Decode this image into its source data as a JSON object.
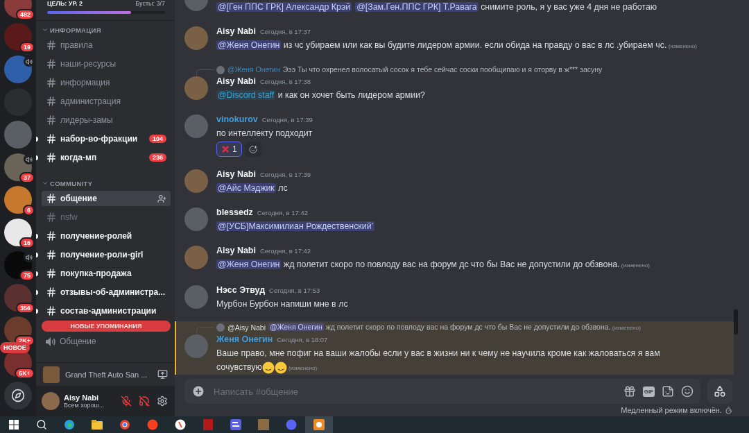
{
  "servers": [
    {
      "badge": "482",
      "speaker": false
    },
    {
      "badge": "19",
      "speaker": false
    },
    {
      "speaker": true
    },
    {
      "speaker": false
    },
    {
      "speaker": false
    },
    {
      "badge": "37",
      "speaker": true
    },
    {
      "badge": "6",
      "speaker": false
    },
    {
      "badge": "16",
      "speaker": false
    },
    {
      "badge": "75",
      "speaker": true
    },
    {
      "badge": "356",
      "speaker": false
    },
    {
      "badge": "2K+",
      "speaker": false
    },
    {
      "badge": "5K+",
      "speaker": false,
      "pill": "НОВОЕ"
    }
  ],
  "boost": {
    "goal": "ЦЕЛЬ: УР. 2",
    "count": "Бусты: 3/7",
    "level": 0.71
  },
  "categories": [
    {
      "name": "ИНФОРМАЦИЯ",
      "expanded": true,
      "channels": [
        {
          "name": "правила",
          "kind": "text",
          "unread": false,
          "selected": false
        },
        {
          "name": "наши-ресурсы",
          "kind": "text",
          "unread": false,
          "selected": false
        },
        {
          "name": "информация",
          "kind": "text",
          "unread": false,
          "selected": false
        },
        {
          "name": "администрация",
          "kind": "text",
          "unread": false,
          "selected": false
        },
        {
          "name": "лидеры-замы",
          "kind": "text",
          "unread": false,
          "selected": false
        },
        {
          "name": "набор-во-фракции",
          "kind": "text",
          "unread": true,
          "selected": false,
          "badge": "104"
        },
        {
          "name": "когда-мп",
          "kind": "text",
          "unread": true,
          "selected": false,
          "badge": "236"
        }
      ]
    },
    {
      "name": "COMMUNITY",
      "expanded": true,
      "channels": [
        {
          "name": "общение",
          "kind": "text",
          "unread": false,
          "selected": true
        },
        {
          "name": "nsfw",
          "kind": "nsfw",
          "unread": false,
          "selected": false
        },
        {
          "name": "получение-ролей",
          "kind": "text",
          "unread": true,
          "selected": false
        },
        {
          "name": "получение-роли-girl",
          "kind": "text",
          "unread": true,
          "selected": false
        },
        {
          "name": "покупка-продажа",
          "kind": "text",
          "unread": true,
          "selected": false
        },
        {
          "name": "отзывы-об-администра...",
          "kind": "text",
          "unread": true,
          "selected": false
        },
        {
          "name": "состав-администрации",
          "kind": "text",
          "unread": true,
          "selected": false
        },
        {
          "name": "Общение",
          "kind": "voice",
          "selected": false
        }
      ]
    }
  ],
  "mentions_banner": "НОВЫЕ УПОМИНАНИЯ",
  "activity": {
    "game": "Grand Theft Auto San ..."
  },
  "user": {
    "name": "Aisy Nabi",
    "status": "Всем хорош...",
    "muted": true,
    "deafened": true
  },
  "messages": [
    {
      "kind": "partial",
      "highlighted": false,
      "content": [
        {
          "kind": "mention",
          "text": "@[Ген ППС ГРК] Александр Крэй"
        },
        {
          "kind": "mention",
          "text": "@[Зам.Ген.ППС ГРК] Т.Равага"
        },
        {
          "kind": "text",
          "text": " снимите роль, я у вас уже 4 дня не работаю"
        }
      ]
    },
    {
      "kind": "full",
      "highlighted": false,
      "author": "Aisy Nabi",
      "color": "#f2f3f5",
      "time": "Сегодня, в 17:37",
      "edited": "(изменено)",
      "content": [
        {
          "kind": "mention",
          "text": "@Женя Онегин"
        },
        {
          "kind": "text",
          "text": " из чс убираем или как вы будите лидером армии. если обида на правду о вас в лс .убираем чс."
        }
      ]
    },
    {
      "kind": "full",
      "highlighted": false,
      "reply": {
        "author": "@Женя Онегин",
        "color": "#3e8cbf",
        "content": [
          {
            "kind": "text",
            "text": "Эээ Ты что охренел волосатый сосок я тебе сейчас соски пообщипаю и я оторву в ж*** засуну"
          }
        ]
      },
      "author": "Aisy Nabi",
      "color": "#f2f3f5",
      "time": "Сегодня, в 17:38",
      "content": [
        {
          "kind": "role",
          "text": "@Discord staff"
        },
        {
          "kind": "text",
          "text": " и как он хочет быть лидером армии?"
        }
      ]
    },
    {
      "kind": "full",
      "highlighted": false,
      "author": "vinokurov",
      "color": "#3e9fe0",
      "time": "Сегодня, в 17:39",
      "content": [
        {
          "kind": "text",
          "text": "по интеллекту подходит"
        }
      ],
      "reactions": [
        {
          "count": "1",
          "selected": true
        }
      ]
    },
    {
      "kind": "full",
      "highlighted": false,
      "author": "Aisy Nabi",
      "color": "#f2f3f5",
      "time": "Сегодня, в 17:39",
      "content": [
        {
          "kind": "mention",
          "text": "@Айс Мэджик"
        },
        {
          "kind": "text",
          "text": " лс"
        }
      ]
    },
    {
      "kind": "full",
      "highlighted": false,
      "author": "blessedz",
      "color": "#f2f3f5",
      "time": "Сегодня, в 17:42",
      "content": [
        {
          "kind": "mention",
          "text": "@[УСБ]Максимилиан Рождественский’"
        }
      ]
    },
    {
      "kind": "full",
      "highlighted": false,
      "author": "Aisy Nabi",
      "color": "#f2f3f5",
      "time": "Сегодня, в 17:42",
      "edited": "(изменено)",
      "content": [
        {
          "kind": "mention",
          "text": "@Женя Онегин"
        },
        {
          "kind": "text",
          "text": " жд полетит скоро по повлоду вас на форум дс что бы Вас не допустили до обзвона."
        }
      ]
    },
    {
      "kind": "full",
      "highlighted": false,
      "author": "Нэсс Этвуд",
      "color": "#f2f3f5",
      "time": "Сегодня, в 17:53",
      "content": [
        {
          "kind": "text",
          "text": "Мурбон Бурбон напиши мне в лс"
        }
      ]
    },
    {
      "kind": "full",
      "highlighted": true,
      "reply": {
        "author": "@Aisy Nabi",
        "color": "#dbdee1",
        "edited": "(изменено)",
        "content": [
          {
            "kind": "mention",
            "text": "@Женя Онегин"
          },
          {
            "kind": "text",
            "text": " жд полетит скоро по повлоду вас на форум дс что бы Вас не допустили до обзвона."
          }
        ]
      },
      "author": "Женя Онегин",
      "color": "#3e9fe0",
      "time": "Сегодня, в 18:07",
      "edited": "(изменено)",
      "content": [
        {
          "kind": "text",
          "text": "Ваше право, мне пофиг на ваши жалобы если у вас в жизни ни к чему не научила кроме как жаловаться я вам сочувствую"
        },
        {
          "kind": "emoji"
        },
        {
          "kind": "emoji"
        }
      ]
    }
  ],
  "composer": {
    "placeholder": "Написать #общение",
    "gif": "GIF"
  },
  "slowmode": "Медленный режим включён.",
  "taskbar": [
    {
      "kind": "windows",
      "selected": false
    },
    {
      "kind": "search",
      "selected": false
    },
    {
      "kind": "edge",
      "selected": false
    },
    {
      "kind": "folder",
      "selected": false
    },
    {
      "kind": "chrome",
      "selected": false
    },
    {
      "kind": "yandex",
      "selected": false
    },
    {
      "kind": "browser",
      "selected": false
    },
    {
      "kind": "video",
      "selected": false
    },
    {
      "kind": "tasks",
      "selected": false
    },
    {
      "kind": "game",
      "selected": false
    },
    {
      "kind": "discord",
      "selected": false
    },
    {
      "kind": "camera",
      "selected": true
    }
  ]
}
